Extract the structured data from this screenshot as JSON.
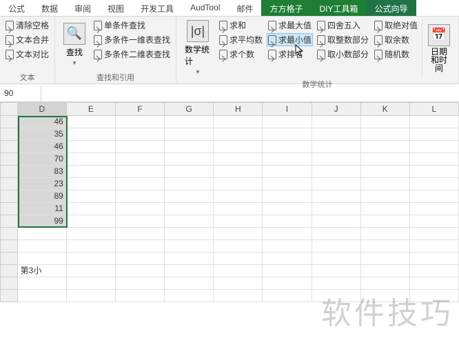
{
  "tabs": [
    "公式",
    "数据",
    "审阅",
    "视图",
    "开发工具",
    "AudTool",
    "邮件",
    "方方格子",
    "DIY工具箱",
    "公式向导"
  ],
  "active_tab": 9,
  "ribbon": {
    "g1": {
      "items": [
        "清除空格",
        "文本合并",
        "文本对比"
      ],
      "label": "文本"
    },
    "g2": {
      "btn": "查找",
      "items": [
        "单条件查找",
        "多条件一维表查找",
        "多条件二维表查找"
      ],
      "label": "查找和引用"
    },
    "g3": {
      "btn": "数学统计",
      "items1": [
        "求和",
        "求平均数",
        "求个数"
      ],
      "items2": [
        "求最大值",
        "求最小值",
        "求排名"
      ],
      "items3": [
        "四舍五入",
        "取整数部分",
        "取小数部分"
      ],
      "items4": [
        "取绝对值",
        "取余数",
        "随机数"
      ],
      "right": "日期和时间",
      "label": "数学统计"
    }
  },
  "namebox": "90",
  "cols": [
    "D",
    "E",
    "F",
    "G",
    "H",
    "I",
    "J",
    "K",
    "L"
  ],
  "rows": 15,
  "data_d": [
    "46",
    "35",
    "46",
    "70",
    "83",
    "23",
    "89",
    "11",
    "99"
  ],
  "d3_text": "第3小",
  "watermark": "软件技巧",
  "hover_cmd": "求最小值",
  "chart_data": {
    "type": "table",
    "columns": [
      "D"
    ],
    "values": [
      46,
      35,
      46,
      70,
      83,
      23,
      89,
      11,
      99
    ]
  }
}
